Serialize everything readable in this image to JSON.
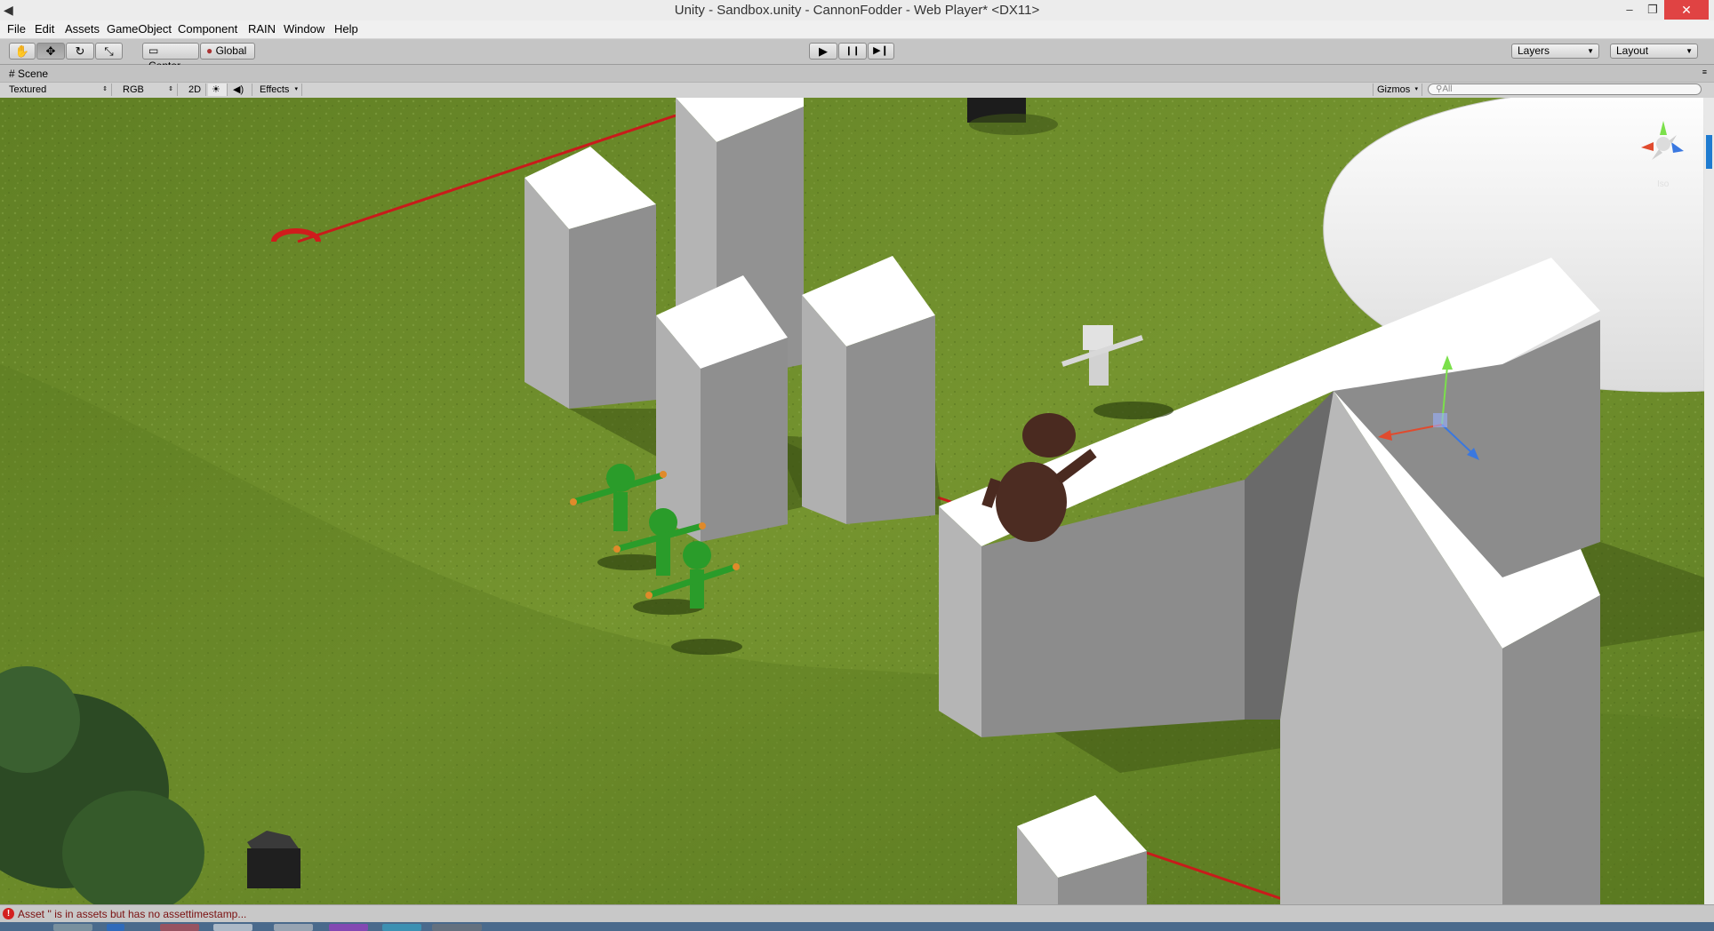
{
  "window": {
    "title": "Unity - Sandbox.unity - CannonFodder - Web Player* <DX11>",
    "minimize_glyph": "‒",
    "maximize_glyph": "❐",
    "close_glyph": "✕"
  },
  "menu": {
    "items": [
      "File",
      "Edit",
      "Assets",
      "GameObject",
      "Component",
      "RAIN",
      "Window",
      "Help"
    ]
  },
  "toolbar": {
    "tools": [
      {
        "name": "hand-tool",
        "glyph": "✋",
        "active": false
      },
      {
        "name": "move-tool",
        "glyph": "✥",
        "active": true
      },
      {
        "name": "rotate-tool",
        "glyph": "↻",
        "active": false
      },
      {
        "name": "scale-tool",
        "glyph": "⤡",
        "active": false
      }
    ],
    "pivot_label": "Center",
    "space_label": "Global",
    "play_glyph": "▶",
    "pause_glyph": "❙❙",
    "step_glyph": "▶❙",
    "layers_label": "Layers",
    "layout_label": "Layout"
  },
  "scene_tab": {
    "label": "Scene"
  },
  "scene_toolbar": {
    "render_mode": "Textured",
    "color_mode": "RGB",
    "mode_2d": "2D",
    "lighting_glyph": "☀",
    "audio_glyph": "🔈",
    "effects_label": "Effects",
    "gizmos_label": "Gizmos",
    "search_placeholder": "All"
  },
  "scene_view": {
    "orientation_label": "Iso",
    "colors": {
      "grass": "#6b8a2c",
      "waypoint_line": "#c81b1b",
      "block": "#ffffff",
      "soldier": "#2a9c2a"
    }
  },
  "status": {
    "message": "Asset '' is in assets but has no assettimestamp..."
  }
}
